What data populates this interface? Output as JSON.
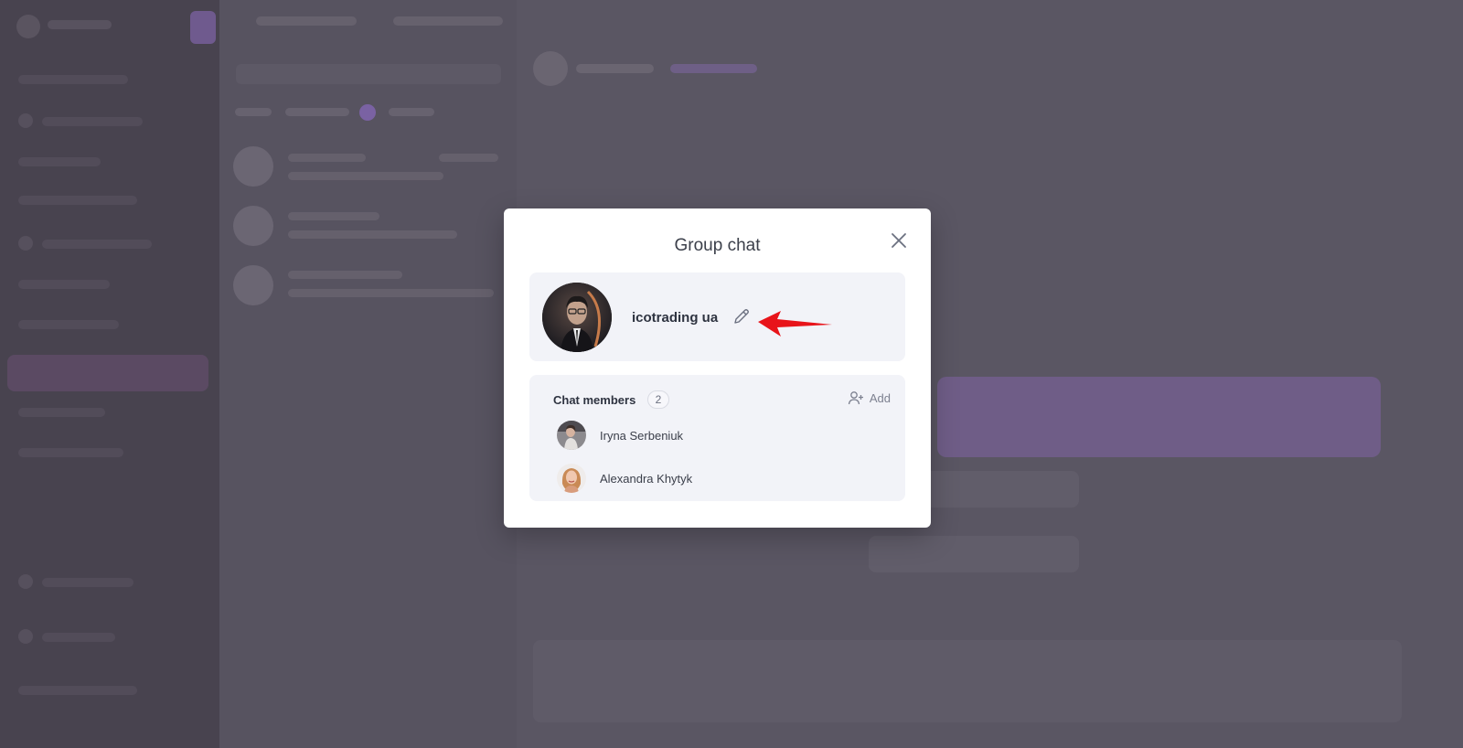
{
  "modal": {
    "title": "Group chat",
    "group_name": "icotrading ua",
    "members_label": "Chat members",
    "members_count": "2",
    "add_label": "Add",
    "members": [
      {
        "name": "Iryna Serbeniuk"
      },
      {
        "name": "Alexandra Khytyk"
      }
    ]
  },
  "icons": {
    "close": "close-icon",
    "edit": "pencil-icon",
    "add": "add-user-icon",
    "annotation": "red-arrow"
  },
  "colors": {
    "overlay": "#5a5562",
    "card_bg": "#f2f3f8",
    "accent": "#7a62a3",
    "annotation_arrow": "#e8141a"
  }
}
